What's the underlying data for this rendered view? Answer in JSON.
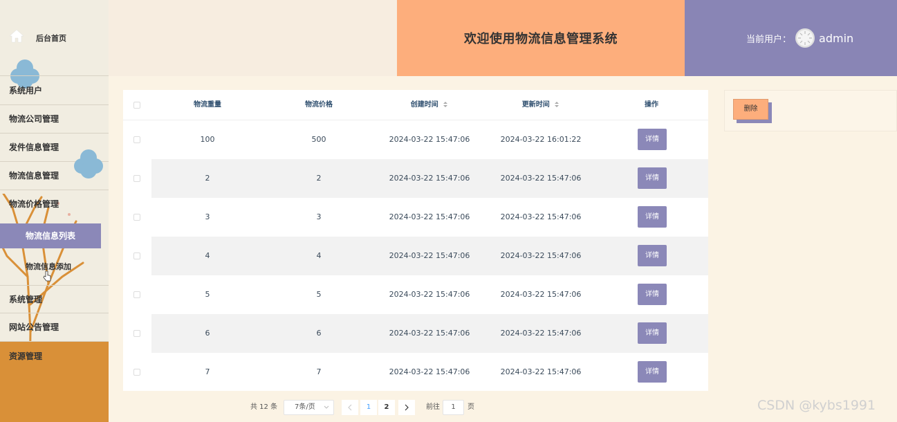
{
  "sidebar": {
    "home_label": "后台首页",
    "items": [
      {
        "label": "系统用户"
      },
      {
        "label": "物流公司管理"
      },
      {
        "label": "发件信息管理"
      },
      {
        "label": "物流信息管理"
      },
      {
        "label": "物流价格管理"
      },
      {
        "label": "系统管理"
      },
      {
        "label": "网站公告管理"
      },
      {
        "label": "资源管理"
      }
    ],
    "submenu_active": "物流信息列表",
    "submenu_item": "物流信息添加"
  },
  "header": {
    "title": "欢迎使用物流信息管理系统",
    "user_label": "当前用户：",
    "user_name": "admin"
  },
  "table": {
    "columns": [
      "物流重量",
      "物流价格",
      "创建时间",
      "更新时间",
      "操作"
    ],
    "rows": [
      {
        "weight": "100",
        "price": "500",
        "created": "2024-03-22 15:47:06",
        "updated": "2024-03-22 16:01:22",
        "action": "详情"
      },
      {
        "weight": "2",
        "price": "2",
        "created": "2024-03-22 15:47:06",
        "updated": "2024-03-22 15:47:06",
        "action": "详情"
      },
      {
        "weight": "3",
        "price": "3",
        "created": "2024-03-22 15:47:06",
        "updated": "2024-03-22 15:47:06",
        "action": "详情"
      },
      {
        "weight": "4",
        "price": "4",
        "created": "2024-03-22 15:47:06",
        "updated": "2024-03-22 15:47:06",
        "action": "详情"
      },
      {
        "weight": "5",
        "price": "5",
        "created": "2024-03-22 15:47:06",
        "updated": "2024-03-22 15:47:06",
        "action": "详情"
      },
      {
        "weight": "6",
        "price": "6",
        "created": "2024-03-22 15:47:06",
        "updated": "2024-03-22 15:47:06",
        "action": "详情"
      },
      {
        "weight": "7",
        "price": "7",
        "created": "2024-03-22 15:47:06",
        "updated": "2024-03-22 15:47:06",
        "action": "详情"
      }
    ]
  },
  "actions": {
    "delete_label": "删除"
  },
  "pagination": {
    "total": "共 12 条",
    "page_size": "7条/页",
    "pages": [
      "1",
      "2"
    ],
    "current_page": "1",
    "goto_label": "前往",
    "goto_value": "1",
    "page_suffix": "页"
  },
  "watermark": "CSDN @kybs1991",
  "colors": {
    "accent_purple": "#8b88b8",
    "accent_orange": "#fdae7c",
    "sidebar_orange": "#d99038",
    "background": "#fbf3e4"
  }
}
